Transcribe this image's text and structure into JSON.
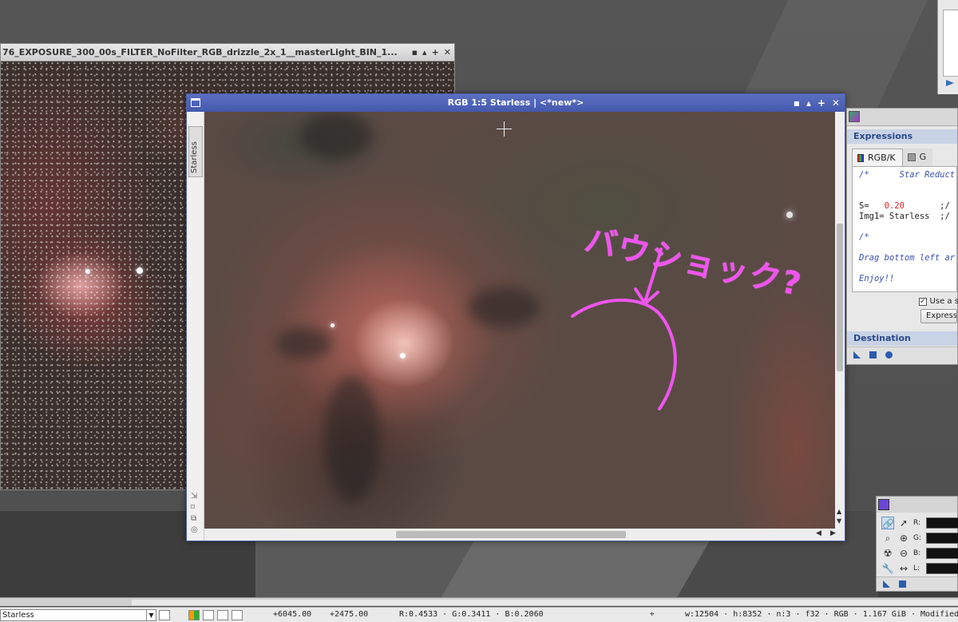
{
  "background_window": {
    "title": "76_EXPOSURE_300_00s_FILTER_NoFilter_RGB_drizzle_2x_1__masterLight_BIN_1...",
    "controls": [
      "▪",
      "▴",
      "+",
      "✕"
    ]
  },
  "main_window": {
    "title": "RGB 1:5 Starless | <*new*>",
    "controls": [
      "▪",
      "▴",
      "+",
      "✕"
    ],
    "side_tab_label": "Starless"
  },
  "annotation": {
    "text": "バウショック?",
    "color": "#ee55ee"
  },
  "expressions_panel": {
    "section_expressions": "Expressions",
    "tabs": [
      {
        "label": "RGB/K",
        "icon": "rgb-swatch-icon"
      },
      {
        "label": "G",
        "icon": "gray-swatch-icon"
      }
    ],
    "code": {
      "line1": "/*      Star Reduct",
      "line2_var": "S=   ",
      "line2_num": "0.20",
      "line2_rest": "       ;/",
      "line3": "Img1= Starless  ;/",
      "line4": "/*",
      "line5": "Drag bottom left ar",
      "line6": "Enjoy!!"
    },
    "checkbox_label": "Use a s",
    "button_label": "Express",
    "section_destination": "Destination"
  },
  "readout": {
    "labels": [
      "R:",
      "G:",
      "B:",
      "L:"
    ]
  },
  "status_bar": {
    "view_select": "Starless",
    "x": "+6045.00",
    "y": "+2475.00",
    "rgb": "R:0.4533 · G:0.3411 · B:0.2060",
    "info": "w:12504 · h:8352 · n:3 · f32 · RGB · 1.167 GiB · Modified"
  }
}
